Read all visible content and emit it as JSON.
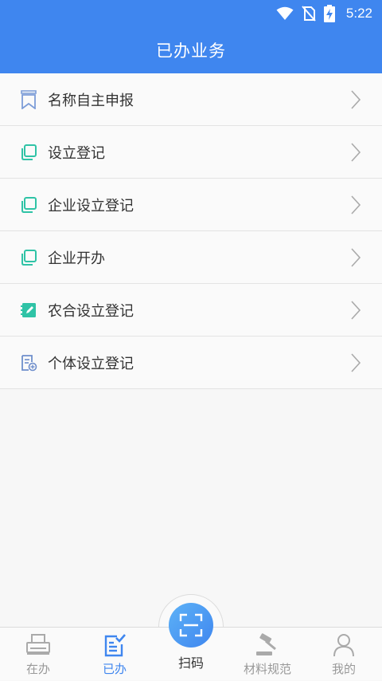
{
  "status": {
    "time": "5:22"
  },
  "header": {
    "title": "已办业务"
  },
  "list": [
    {
      "label": "名称自主申报",
      "icon": "bookmark-icon"
    },
    {
      "label": "设立登记",
      "icon": "copy-icon"
    },
    {
      "label": "企业设立登记",
      "icon": "copy-icon"
    },
    {
      "label": "企业开办",
      "icon": "copy-icon"
    },
    {
      "label": "农合设立登记",
      "icon": "edit-note-icon"
    },
    {
      "label": "个体设立登记",
      "icon": "document-add-icon"
    }
  ],
  "tabs": {
    "pending": "在办",
    "done": "已办",
    "scan": "扫码",
    "materials": "材料规范",
    "mine": "我的"
  },
  "colors": {
    "primary": "#3f86ef",
    "teal": "#2fc3a6",
    "inactive": "#999999"
  }
}
